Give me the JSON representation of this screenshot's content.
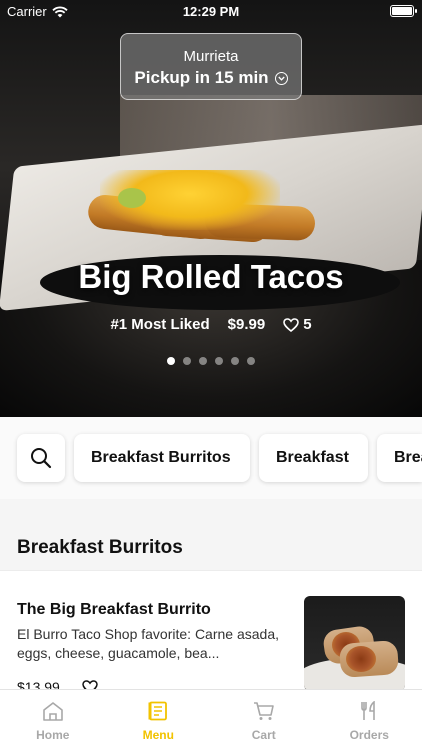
{
  "status_bar": {
    "carrier": "Carrier",
    "time": "12:29 PM"
  },
  "location": {
    "city": "Murrieta",
    "pickup": "Pickup in 15 min"
  },
  "hero": {
    "title": "Big Rolled Tacos",
    "badge": "#1 Most Liked",
    "price": "$9.99",
    "likes": "5",
    "carousel_pages": 6,
    "carousel_active_index": 0
  },
  "categories": {
    "chips": [
      "Breakfast Burritos",
      "Breakfast",
      "Brea"
    ]
  },
  "section": {
    "title": "Breakfast Burritos"
  },
  "item": {
    "name": "The Big Breakfast Burrito",
    "description": "El Burro Taco Shop favorite: Carne asada, eggs, cheese, guacamole, bea...",
    "price": "$13.99"
  },
  "tabs": [
    {
      "label": "Home",
      "icon": "home-icon",
      "active": false
    },
    {
      "label": "Menu",
      "icon": "menu-icon",
      "active": true
    },
    {
      "label": "Cart",
      "icon": "cart-icon",
      "active": false
    },
    {
      "label": "Orders",
      "icon": "fork-knife-icon",
      "active": false
    }
  ],
  "colors": {
    "accent": "#f2c300",
    "inactive": "#a8a8a8"
  }
}
